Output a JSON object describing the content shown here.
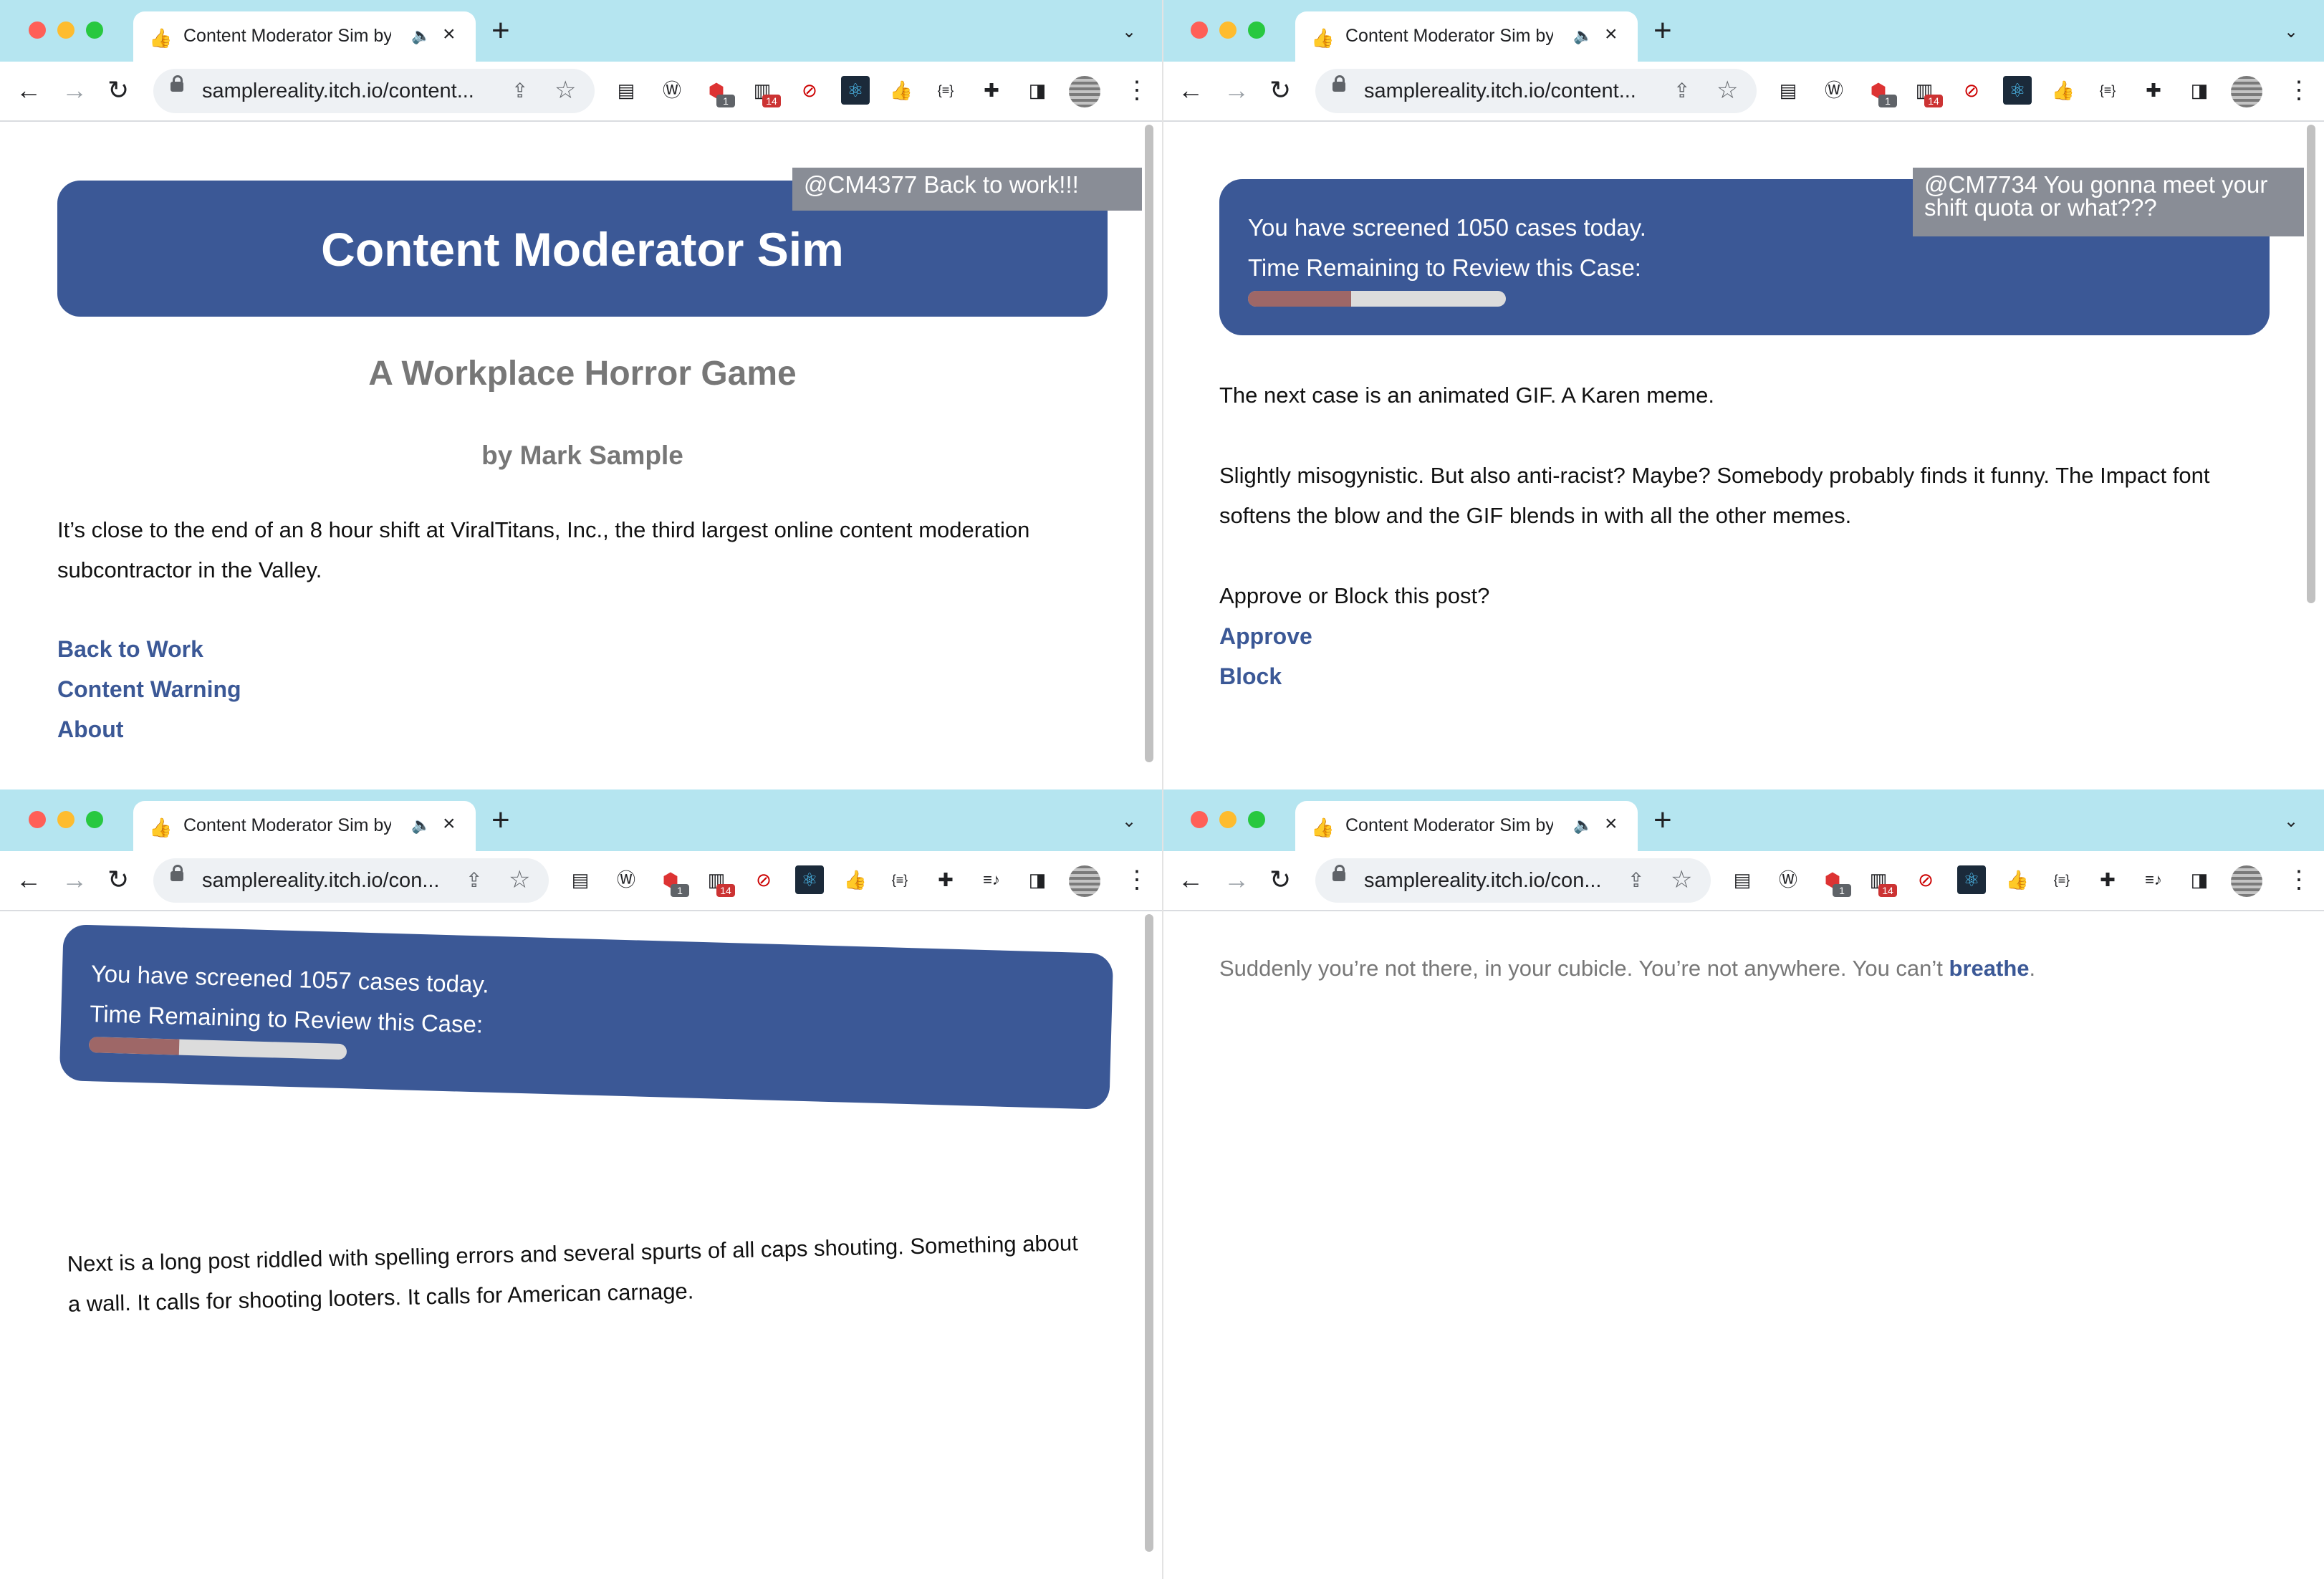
{
  "colors": {
    "tabbar_bg": "#b5e5f0",
    "panel_blue": "#3b5896",
    "bubble_grey": "#898d96",
    "link_blue": "#3b5896",
    "bar_fill": "#9e6767",
    "bar_track": "#dcdcdc",
    "light_red": "#ff5f57",
    "light_yellow": "#febc2e",
    "light_green": "#28c840"
  },
  "browser": {
    "tab_title": "Content Moderator Sim by",
    "tab_favicon": "thumbs-up-icon",
    "url_long": "samplereality.itch.io/content...",
    "url_short": "samplereality.itch.io/con...",
    "new_tab": "+",
    "extensions": [
      {
        "name": "docs-icon",
        "glyph": "▤"
      },
      {
        "name": "wordpress-icon",
        "glyph": "Ⓦ"
      },
      {
        "name": "adblock-icon",
        "glyph": "⬢",
        "badge": "1"
      },
      {
        "name": "archive-icon",
        "glyph": "▥",
        "badge": "14"
      },
      {
        "name": "no-tracking-icon",
        "glyph": "⊘"
      },
      {
        "name": "react-devtools-icon",
        "glyph": "⚛"
      },
      {
        "name": "thumbs-up-icon",
        "glyph": "👍"
      },
      {
        "name": "json-viewer-icon",
        "glyph": "{≡}"
      },
      {
        "name": "extensions-puzzle-icon",
        "glyph": "✚"
      },
      {
        "name": "media-controls-icon",
        "glyph": "≡♪"
      },
      {
        "name": "side-panel-icon",
        "glyph": "◨"
      }
    ]
  },
  "windows": [
    {
      "id": "title-screen",
      "bubble": "@CM4377 Back to work!!!",
      "title": "Content Moderator Sim",
      "subtitle": "A Workplace Horror Game",
      "byline": "by Mark Sample",
      "intro_line1": "It’s close to the end of an 8 hour shift at ViralTitans, Inc., the third largest online content moderation",
      "intro_line2": "subcontractor in the Valley.",
      "links": [
        "Back to Work",
        "Content Warning",
        "About"
      ]
    },
    {
      "id": "case-karen",
      "bubble": "@CM7734 You gonna meet your shift quota or what???",
      "cases_line": "You have screened 1050 cases today.",
      "timer_label": "Time Remaining to Review this Case:",
      "time_remaining_fraction": 0.4,
      "para1": "The next case is an animated GIF. A Karen meme.",
      "para2_line1": "Slightly misogynistic. But also anti-racist? Maybe? Somebody probably finds it funny. The Impact font",
      "para2_line2": "softens the blow and the GIF blends in with all the other memes.",
      "prompt": "Approve or Block this post?",
      "links": [
        "Approve",
        "Block"
      ]
    },
    {
      "id": "case-long-post",
      "cases_line": "You have screened 1057 cases today.",
      "timer_label": "Time Remaining to Review this Case:",
      "time_remaining_fraction": 0.35,
      "para1_line1": "Next is a long post riddled with spelling errors and several spurts of all caps shouting. Something about",
      "para1_line2": "a wall. It calls for shooting looters. It calls for American carnage."
    },
    {
      "id": "breathe",
      "text_before": "Suddenly you’re not there, in your cubicle. You’re not anywhere. You can’t",
      "link": "breathe",
      "text_after": "."
    }
  ]
}
